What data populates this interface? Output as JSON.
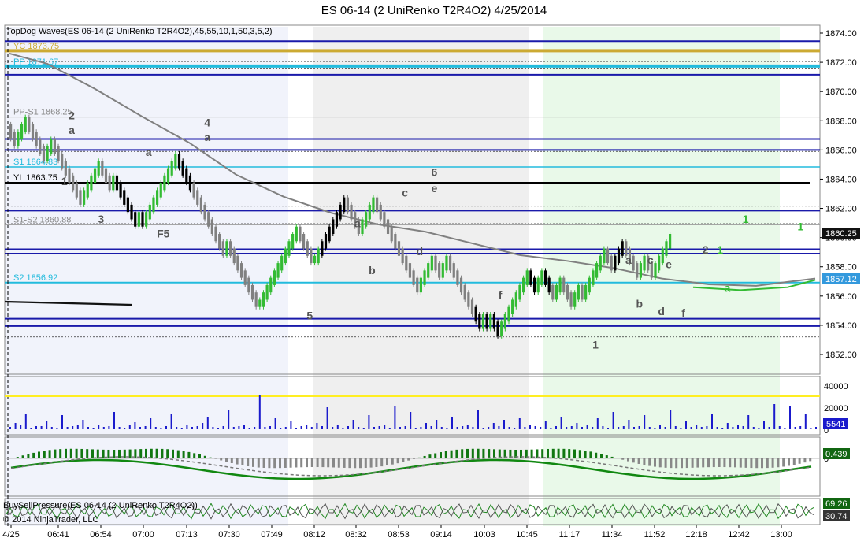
{
  "title": "ES 06-14 (2 UniRenko T2R4O2)  4/25/2014",
  "indicator_label": "TopDog Waves(ES 06-14 (2 UniRenko T2R4O2),45,55,10,1,50,3,5,2)",
  "buysell_label": "BuySellPressure(ES 06-14 (2 UniRenko T2R4O2))",
  "copyright": "© 2014 NinjaTrader, LLC",
  "colors": {
    "up_bar": "#33bb33",
    "down_bar": "#808080",
    "black_bar": "#000000",
    "blue_level": "#1a1aaa",
    "cyan_level": "#22bbdd",
    "gold_level": "#ccaa33",
    "sma": "#808080",
    "volume": "#1a1acc",
    "yellow_line": "#ffee22"
  },
  "chart_data": {
    "type": "candlestick",
    "price_axis": {
      "ticks": [
        "1874.00",
        "1872.00",
        "1870.00",
        "1868.00",
        "1866.00",
        "1864.00",
        "1862.00",
        "1860.00",
        "1858.00",
        "1856.00",
        "1854.00",
        "1852.00"
      ],
      "ylim": [
        1851,
        1874.5
      ]
    },
    "time_axis": [
      "4/25",
      "06:41",
      "06:54",
      "07:00",
      "07:13",
      "07:30",
      "07:49",
      "08:12",
      "08:32",
      "08:53",
      "09:14",
      "10:03",
      "10:45",
      "11:17",
      "11:34",
      "11:52",
      "12:18",
      "12:42",
      "13:00"
    ],
    "last_price": "1860.25",
    "sma_value": "1857.12",
    "levels": [
      {
        "label": "YC 1873.75",
        "value": 1872.75,
        "color": "#ccaa33"
      },
      {
        "label": "PP 1871.67",
        "value": 1871.67,
        "color": "#22bbdd"
      },
      {
        "label": "PP-S1 1868.25",
        "value": 1868.25,
        "color": "#888888"
      },
      {
        "label": "S1 1864.83",
        "value": 1864.83,
        "color": "#22bbdd"
      },
      {
        "label": "YL 1863.75",
        "value": 1863.75,
        "color": "#000000"
      },
      {
        "label": "S1-S2 1860.88",
        "value": 1860.88,
        "color": "#888888"
      },
      {
        "label": "S2 1856.92",
        "value": 1856.92,
        "color": "#22bbdd"
      }
    ],
    "wave_labels": [
      {
        "text": "2",
        "x": 17,
        "price": 1868.1,
        "color": "#555555"
      },
      {
        "text": "a",
        "x": 17,
        "price": 1867.1,
        "color": "#555555"
      },
      {
        "text": "a",
        "x": 38,
        "price": 1865.6,
        "color": "#555555"
      },
      {
        "text": "1",
        "x": 15,
        "price": 1863.6,
        "color": "#555555"
      },
      {
        "text": "3",
        "x": 25,
        "price": 1861.0,
        "color": "#555555"
      },
      {
        "text": "4",
        "x": 54,
        "price": 1867.6,
        "color": "#555555"
      },
      {
        "text": "a",
        "x": 54,
        "price": 1866.6,
        "color": "#555555"
      },
      {
        "text": "F5",
        "x": 42,
        "price": 1860.0,
        "color": "#555555"
      },
      {
        "text": "5",
        "x": 82,
        "price": 1854.4,
        "color": "#555555"
      },
      {
        "text": "a",
        "x": 95,
        "price": 1860.7,
        "color": "#555555"
      },
      {
        "text": "b",
        "x": 99,
        "price": 1857.5,
        "color": "#555555"
      },
      {
        "text": "c",
        "x": 108,
        "price": 1862.8,
        "color": "#555555"
      },
      {
        "text": "6",
        "x": 116,
        "price": 1864.2,
        "color": "#555555"
      },
      {
        "text": "e",
        "x": 116,
        "price": 1863.1,
        "color": "#555555"
      },
      {
        "text": "d",
        "x": 112,
        "price": 1858.8,
        "color": "#555555"
      },
      {
        "text": "f",
        "x": 134,
        "price": 1855.8,
        "color": "#555555"
      },
      {
        "text": "1",
        "x": 160,
        "price": 1852.4,
        "color": "#555555"
      },
      {
        "text": "a",
        "x": 169,
        "price": 1858.2,
        "color": "#555555"
      },
      {
        "text": "b",
        "x": 172,
        "price": 1855.2,
        "color": "#555555"
      },
      {
        "text": "c",
        "x": 175,
        "price": 1858.2,
        "color": "#555555"
      },
      {
        "text": "d",
        "x": 178,
        "price": 1854.7,
        "color": "#555555"
      },
      {
        "text": "e",
        "x": 180,
        "price": 1857.9,
        "color": "#555555"
      },
      {
        "text": "f",
        "x": 184,
        "price": 1854.6,
        "color": "#555555"
      },
      {
        "text": "2",
        "x": 190,
        "price": 1858.9,
        "color": "#555555"
      },
      {
        "text": "1",
        "x": 194,
        "price": 1858.9,
        "color": "#33bb33"
      },
      {
        "text": "1",
        "x": 201,
        "price": 1861.0,
        "color": "#33bb33"
      },
      {
        "text": "a",
        "x": 196,
        "price": 1856.3,
        "color": "#33bb33"
      },
      {
        "text": "1",
        "x": 216,
        "price": 1860.5,
        "color": "#33bb33"
      }
    ],
    "volume_axis": [
      "40000",
      "20000",
      "0"
    ],
    "volume_last": "5541",
    "oscillator_last": "0.439",
    "buysell_values": [
      "69.26",
      "30.74"
    ]
  }
}
